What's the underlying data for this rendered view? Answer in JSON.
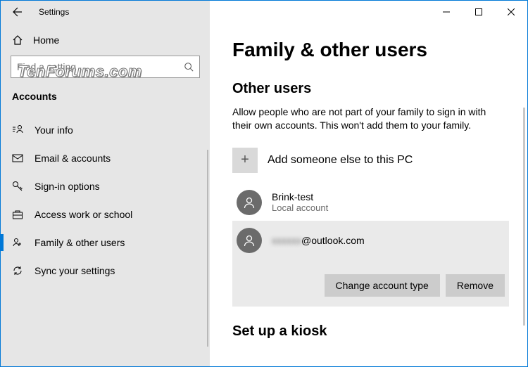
{
  "window": {
    "title": "Settings"
  },
  "sidebar": {
    "home_label": "Home",
    "search_placeholder": "Find a setting",
    "category": "Accounts",
    "items": [
      {
        "label": "Your info"
      },
      {
        "label": "Email & accounts"
      },
      {
        "label": "Sign-in options"
      },
      {
        "label": "Access work or school"
      },
      {
        "label": "Family & other users"
      },
      {
        "label": "Sync your settings"
      }
    ],
    "active_index": 4
  },
  "page": {
    "title": "Family & other users",
    "other_users": {
      "heading": "Other users",
      "description": "Allow people who are not part of your family to sign in with their own accounts. This won't add them to your family.",
      "add_label": "Add someone else to this PC",
      "users": [
        {
          "name": "Brink-test",
          "sub": "Local account",
          "selected": false
        },
        {
          "name": "@outlook.com",
          "sub": "",
          "selected": true,
          "obscured_prefix": "xxxxxx"
        }
      ],
      "actions": {
        "change_type": "Change account type",
        "remove": "Remove"
      }
    },
    "kiosk_heading": "Set up a kiosk"
  },
  "watermark": "TenForums.com"
}
